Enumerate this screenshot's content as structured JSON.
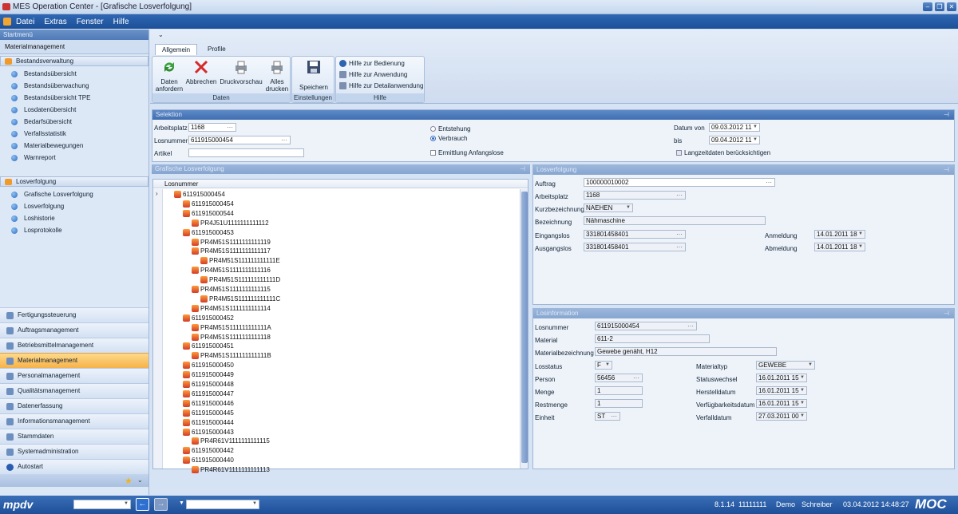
{
  "window": {
    "title": "MES Operation Center - [Grafische Losverfolgung]"
  },
  "menu": [
    "Datei",
    "Extras",
    "Fenster",
    "Hilfe"
  ],
  "sidebar": {
    "header": "Startmenü",
    "module_title": "Materialmanagement",
    "sections": [
      {
        "title": "Bestandsverwaltung",
        "items": [
          "Bestandsübersicht",
          "Bestandsüberwachung",
          "Bestandsübersicht TPE",
          "Losdatenübersicht",
          "Bedarfsübersicht",
          "Verfallsstatistik",
          "Materialbewegungen",
          "Warnreport"
        ]
      },
      {
        "title": "Losverfolgung",
        "items": [
          "Grafische Losverfolgung",
          "Losverfolgung",
          "Loshistorie",
          "Losprotokolle"
        ]
      }
    ],
    "nav": [
      "Fertigungssteuerung",
      "Auftragsmanagement",
      "Betriebsmittelmanagement",
      "Materialmanagement",
      "Personalmanagement",
      "Qualitätsmanagement",
      "Datenerfassung",
      "Informationsmanagement",
      "Stammdaten",
      "Systemadministration",
      "Autostart"
    ],
    "active_nav": "Materialmanagement"
  },
  "ribbon": {
    "tabs": [
      "Allgemein",
      "Profile"
    ],
    "groups": {
      "daten": {
        "label": "Daten",
        "buttons": [
          "Daten\nanfordern",
          "Abbrechen",
          "Druckvorschau",
          "Alles\ndrucken"
        ]
      },
      "einstellungen": {
        "label": "Einstellungen",
        "buttons": [
          "Speichern"
        ]
      },
      "hilfe": {
        "label": "Hilfe",
        "buttons": [
          "Hilfe zur Bedienung",
          "Hilfe zur Anwendung",
          "Hilfe zur Detailanwendung"
        ]
      }
    }
  },
  "selektion": {
    "title": "Selektion",
    "arbeitsplatz_label": "Arbeitsplatz",
    "arbeitsplatz": "1168",
    "losnummer_label": "Losnummer",
    "losnummer": "611915000454",
    "artikel_label": "Artikel",
    "artikel": "",
    "radio_entstehung": "Entstehung",
    "radio_verbrauch": "Verbrauch",
    "check_anfangslose": "Ermittlung Anfangslose",
    "datum_von_label": "Datum von",
    "datum_von": "09.03.2012 11",
    "bis_label": "bis",
    "bis": "09.04.2012 11",
    "check_langzeit": "Langzeitdaten berücksichtigen"
  },
  "tree": {
    "title": "Grafische Losverfolgung",
    "column": "Losnummer",
    "nodes": [
      "611915000454",
      "611915000454",
      "611915000544",
      "PR4J51U1111111111112",
      "611915000453",
      "PR4M51S1111111111119",
      "PR4M51S1111111111117",
      "PR4M51S111111111111E",
      "PR4M51S1111111111116",
      "PR4M51S111111111111D",
      "PR4M51S1111111111115",
      "PR4M51S111111111111C",
      "PR4M51S1111111111114",
      "611915000452",
      "PR4M51S111111111111A",
      "PR4M51S1111111111118",
      "611915000451",
      "PR4M51S111111111111B",
      "611915000450",
      "611915000449",
      "611915000448",
      "611915000447",
      "611915000446",
      "611915000445",
      "611915000444",
      "611915000443",
      "PR4R61V1111111111115",
      "611915000442",
      "611915000440",
      "PR4R61V1111111111113"
    ]
  },
  "losverfolgung": {
    "title": "Losverfolgung",
    "auftrag_label": "Auftrag",
    "auftrag": "100000010002",
    "arbeitsplatz_label": "Arbeitsplatz",
    "arbeitsplatz": "1168",
    "kurzbez_label": "Kurzbezeichnung",
    "kurzbez": "NAEHEN",
    "bezeichnung_label": "Bezeichnung",
    "bezeichnung": "Nähmaschine",
    "eingangslos_label": "Eingangslos",
    "eingangslos": "331801458401",
    "ausgangslos_label": "Ausgangslos",
    "ausgangslos": "331801458401",
    "anmeldung_label": "Anmeldung",
    "anmeldung": "14.01.2011 18",
    "abmeldung_label": "Abmeldung",
    "abmeldung": "14.01.2011 18"
  },
  "losinformation": {
    "title": "Losinformation",
    "losnummer_label": "Losnummer",
    "losnummer": "611915000454",
    "material_label": "Material",
    "material": "611-2",
    "materialbez_label": "Materialbezeichnung",
    "materialbez": "Gewebe genäht, H12",
    "losstatus_label": "Losstatus",
    "losstatus": "F",
    "person_label": "Person",
    "person": "56456",
    "menge_label": "Menge",
    "menge": "1",
    "restmenge_label": "Restmenge",
    "restmenge": "1",
    "einheit_label": "Einheit",
    "einheit": "ST",
    "materialtyp_label": "Materialtyp",
    "materialtyp": "GEWEBE",
    "statuswechsel_label": "Statuswechsel",
    "statuswechsel": "16.01.2011 15",
    "herstelldatum_label": "Herstelldatum",
    "herstelldatum": "16.01.2011 15",
    "verfuegbarkeit_label": "Verfügbarkeitsdatum",
    "verfuegbarkeit": "16.01.2011 15",
    "verfalldatum_label": "Verfalldatum",
    "verfalldatum": "27.03.2011 00"
  },
  "statusbar": {
    "logo": "mpdv",
    "version": "8.1.14",
    "number": "11111111",
    "mode": "Demo",
    "user": "Schreiber",
    "datetime": "03.04.2012 14:48:27",
    "brand": "MOC"
  }
}
